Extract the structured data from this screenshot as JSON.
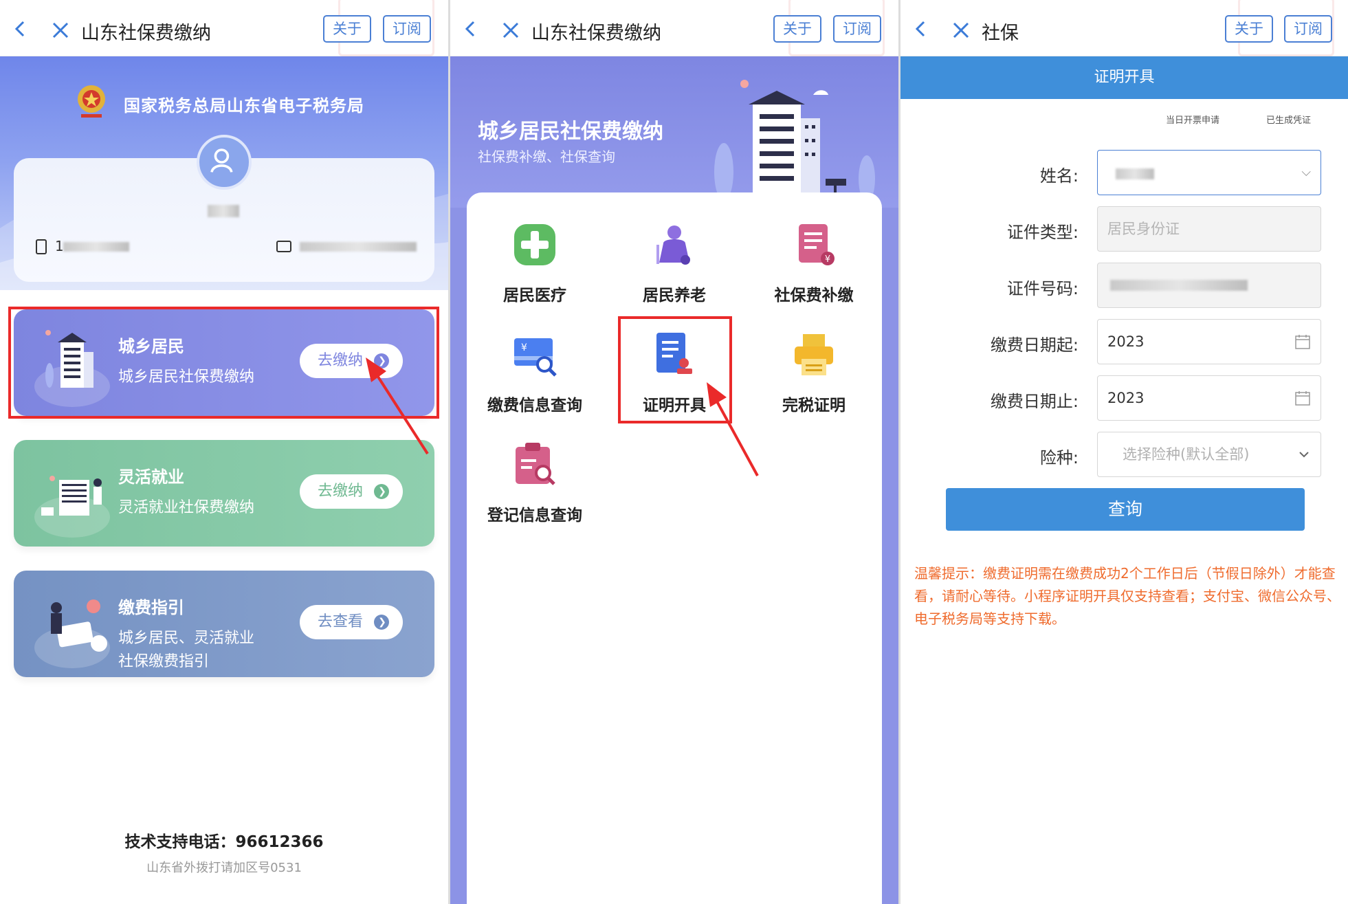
{
  "colors": {
    "primary": "#3f8fda",
    "accent_red": "#ea2a2a",
    "purple": "#8c93e6",
    "green": "#84c7a5",
    "slate": "#7b96c6",
    "tip": "#ef6b2d"
  },
  "panel1": {
    "topbar": {
      "title": "山东社保费缴纳",
      "about": "关于",
      "subscribe": "订阅"
    },
    "agency": "国家税务总局山东省电子税务局",
    "user": {
      "phone_prefix": "1"
    },
    "cards": [
      {
        "title": "城乡居民",
        "subtitle": "城乡居民社保费缴纳",
        "action": "去缴纳"
      },
      {
        "title": "灵活就业",
        "subtitle": "灵活就业社保费缴纳",
        "action": "去缴纳"
      },
      {
        "title": "缴费指引",
        "subtitle_line1": "城乡居民、灵活就业",
        "subtitle_line2": "社保缴费指引",
        "action": "去查看"
      }
    ],
    "hotline": "技术支持电话：96612366",
    "hotline_note": "山东省外拨打请加区号0531"
  },
  "panel2": {
    "topbar": {
      "title": "山东社保费缴纳",
      "about": "关于",
      "subscribe": "订阅"
    },
    "hero_title": "城乡居民社保费缴纳",
    "hero_subtitle": "社保费补缴、社保查询",
    "services": [
      {
        "label": "居民医疗",
        "icon": "medical-cross-icon"
      },
      {
        "label": "居民养老",
        "icon": "elderly-icon"
      },
      {
        "label": "社保费补缴",
        "icon": "supplement-payment-icon"
      },
      {
        "label": "缴费信息查询",
        "icon": "payment-search-icon"
      },
      {
        "label": "证明开具",
        "icon": "certificate-stamp-icon"
      },
      {
        "label": "完税证明",
        "icon": "printer-icon"
      },
      {
        "label": "登记信息查询",
        "icon": "registration-search-icon"
      }
    ]
  },
  "panel3": {
    "topbar": {
      "title": "社保",
      "about": "关于",
      "subscribe": "订阅"
    },
    "band_title": "证明开具",
    "tabs": [
      "当日开票申请",
      "已生成凭证"
    ],
    "form": {
      "name_label": "姓名:",
      "id_type_label": "证件类型:",
      "id_type_value": "居民身份证",
      "id_no_label": "证件号码:",
      "start_label": "缴费日期起:",
      "start_value": "2023",
      "end_label": "缴费日期止:",
      "end_value": "2023",
      "insurance_label": "险种:",
      "insurance_placeholder": "选择险种(默认全部)"
    },
    "query_button": "查询",
    "tip": "温馨提示：缴费证明需在缴费成功2个工作日后（节假日除外）才能查看，请耐心等待。小程序证明开具仅支持查看；支付宝、微信公众号、电子税务局等支持下载。"
  }
}
